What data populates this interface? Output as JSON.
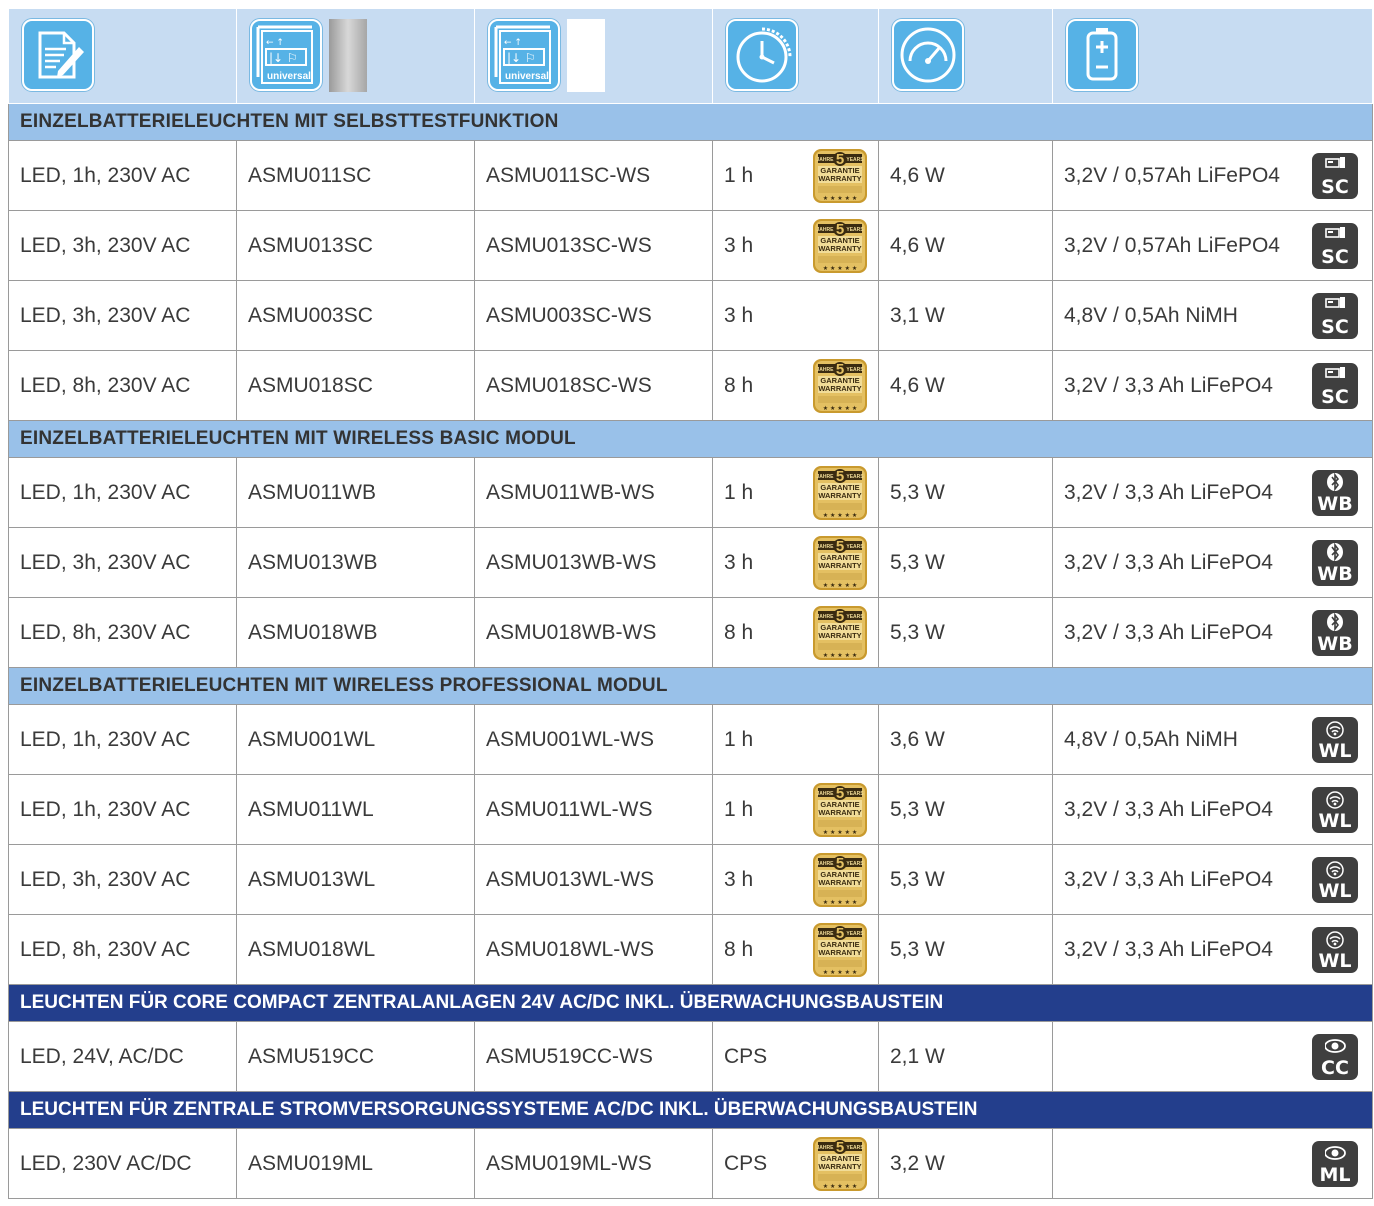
{
  "header_icons": [
    "document-edit-icon",
    "exit-sign-universal-icon",
    "exit-sign-universal-icon",
    "duration-clock-icon",
    "power-gauge-icon",
    "battery-icon"
  ],
  "header_labels": {
    "universal": "universal"
  },
  "swatch_colors": {
    "silver": "#b7b7b7",
    "white": "#ffffff"
  },
  "warranty": {
    "top_left": "JAHRE",
    "number": "5",
    "top_right": "YEARS",
    "line1": "GARANTIE",
    "line2": "WARRANTY"
  },
  "sections": [
    {
      "title": "EINZELBATTERIELEUCHTEN MIT SELBSTTESTFUNKTION",
      "style": "light",
      "rows": [
        {
          "desc": "LED, 1h, 230V AC",
          "art": "ASMU011SC",
          "art_ws": "ASMU011SC-WS",
          "duration": "1 h",
          "warranty": true,
          "power": "4,6 W",
          "battery": "3,2V / 0,57Ah LiFePO4",
          "mark": "SC"
        },
        {
          "desc": "LED, 3h, 230V AC",
          "art": "ASMU013SC",
          "art_ws": "ASMU013SC-WS",
          "duration": "3 h",
          "warranty": true,
          "power": "4,6 W",
          "battery": "3,2V / 0,57Ah LiFePO4",
          "mark": "SC"
        },
        {
          "desc": "LED, 3h, 230V AC",
          "art": "ASMU003SC",
          "art_ws": "ASMU003SC-WS",
          "duration": "3 h",
          "warranty": false,
          "power": "3,1 W",
          "battery": "4,8V / 0,5Ah NiMH",
          "mark": "SC"
        },
        {
          "desc": "LED, 8h, 230V AC",
          "art": "ASMU018SC",
          "art_ws": "ASMU018SC-WS",
          "duration": "8 h",
          "warranty": true,
          "power": "4,6 W",
          "battery": "3,2V / 3,3 Ah LiFePO4",
          "mark": "SC"
        }
      ]
    },
    {
      "title": "EINZELBATTERIELEUCHTEN MIT WIRELESS BASIC MODUL",
      "style": "light",
      "rows": [
        {
          "desc": "LED, 1h, 230V AC",
          "art": "ASMU011WB",
          "art_ws": "ASMU011WB-WS",
          "duration": "1 h",
          "warranty": true,
          "power": "5,3 W",
          "battery": "3,2V / 3,3 Ah LiFePO4",
          "mark": "WB"
        },
        {
          "desc": "LED, 3h, 230V AC",
          "art": "ASMU013WB",
          "art_ws": "ASMU013WB-WS",
          "duration": "3 h",
          "warranty": true,
          "power": "5,3 W",
          "battery": "3,2V / 3,3 Ah LiFePO4",
          "mark": "WB"
        },
        {
          "desc": "LED, 8h, 230V AC",
          "art": "ASMU018WB",
          "art_ws": "ASMU018WB-WS",
          "duration": "8 h",
          "warranty": true,
          "power": "5,3 W",
          "battery": "3,2V / 3,3 Ah LiFePO4",
          "mark": "WB"
        }
      ]
    },
    {
      "title": "EINZELBATTERIELEUCHTEN MIT WIRELESS PROFESSIONAL MODUL",
      "style": "light",
      "rows": [
        {
          "desc": "LED, 1h, 230V AC",
          "art": "ASMU001WL",
          "art_ws": "ASMU001WL-WS",
          "duration": "1 h",
          "warranty": false,
          "power": "3,6 W",
          "battery": "4,8V / 0,5Ah NiMH",
          "mark": "WL"
        },
        {
          "desc": "LED, 1h, 230V AC",
          "art": "ASMU011WL",
          "art_ws": "ASMU011WL-WS",
          "duration": "1 h",
          "warranty": true,
          "power": "5,3 W",
          "battery": "3,2V / 3,3 Ah LiFePO4",
          "mark": "WL"
        },
        {
          "desc": "LED, 3h, 230V AC",
          "art": "ASMU013WL",
          "art_ws": "ASMU013WL-WS",
          "duration": "3 h",
          "warranty": true,
          "power": "5,3 W",
          "battery": "3,2V / 3,3 Ah LiFePO4",
          "mark": "WL"
        },
        {
          "desc": "LED, 8h, 230V AC",
          "art": "ASMU018WL",
          "art_ws": "ASMU018WL-WS",
          "duration": "8 h",
          "warranty": true,
          "power": "5,3 W",
          "battery": "3,2V / 3,3 Ah LiFePO4",
          "mark": "WL"
        }
      ]
    },
    {
      "title": "LEUCHTEN FÜR CORE COMPACT ZENTRALANLAGEN 24V AC/DC INKL. ÜBERWACHUNGSBAUSTEIN",
      "style": "dark",
      "rows": [
        {
          "desc": "LED, 24V, AC/DC",
          "art": "ASMU519CC",
          "art_ws": "ASMU519CC-WS",
          "duration": "CPS",
          "warranty": false,
          "power": "2,1 W",
          "battery": "",
          "mark": "CC"
        }
      ]
    },
    {
      "title": "LEUCHTEN FÜR ZENTRALE STROMVERSORGUNGSSYSTEME AC/DC INKL. ÜBERWACHUNGSBAUSTEIN",
      "style": "dark",
      "rows": [
        {
          "desc": "LED, 230V AC/DC",
          "art": "ASMU019ML",
          "art_ws": "ASMU019ML-WS",
          "duration": "CPS",
          "warranty": true,
          "power": "3,2 W",
          "battery": "",
          "mark": "ML"
        }
      ]
    }
  ]
}
